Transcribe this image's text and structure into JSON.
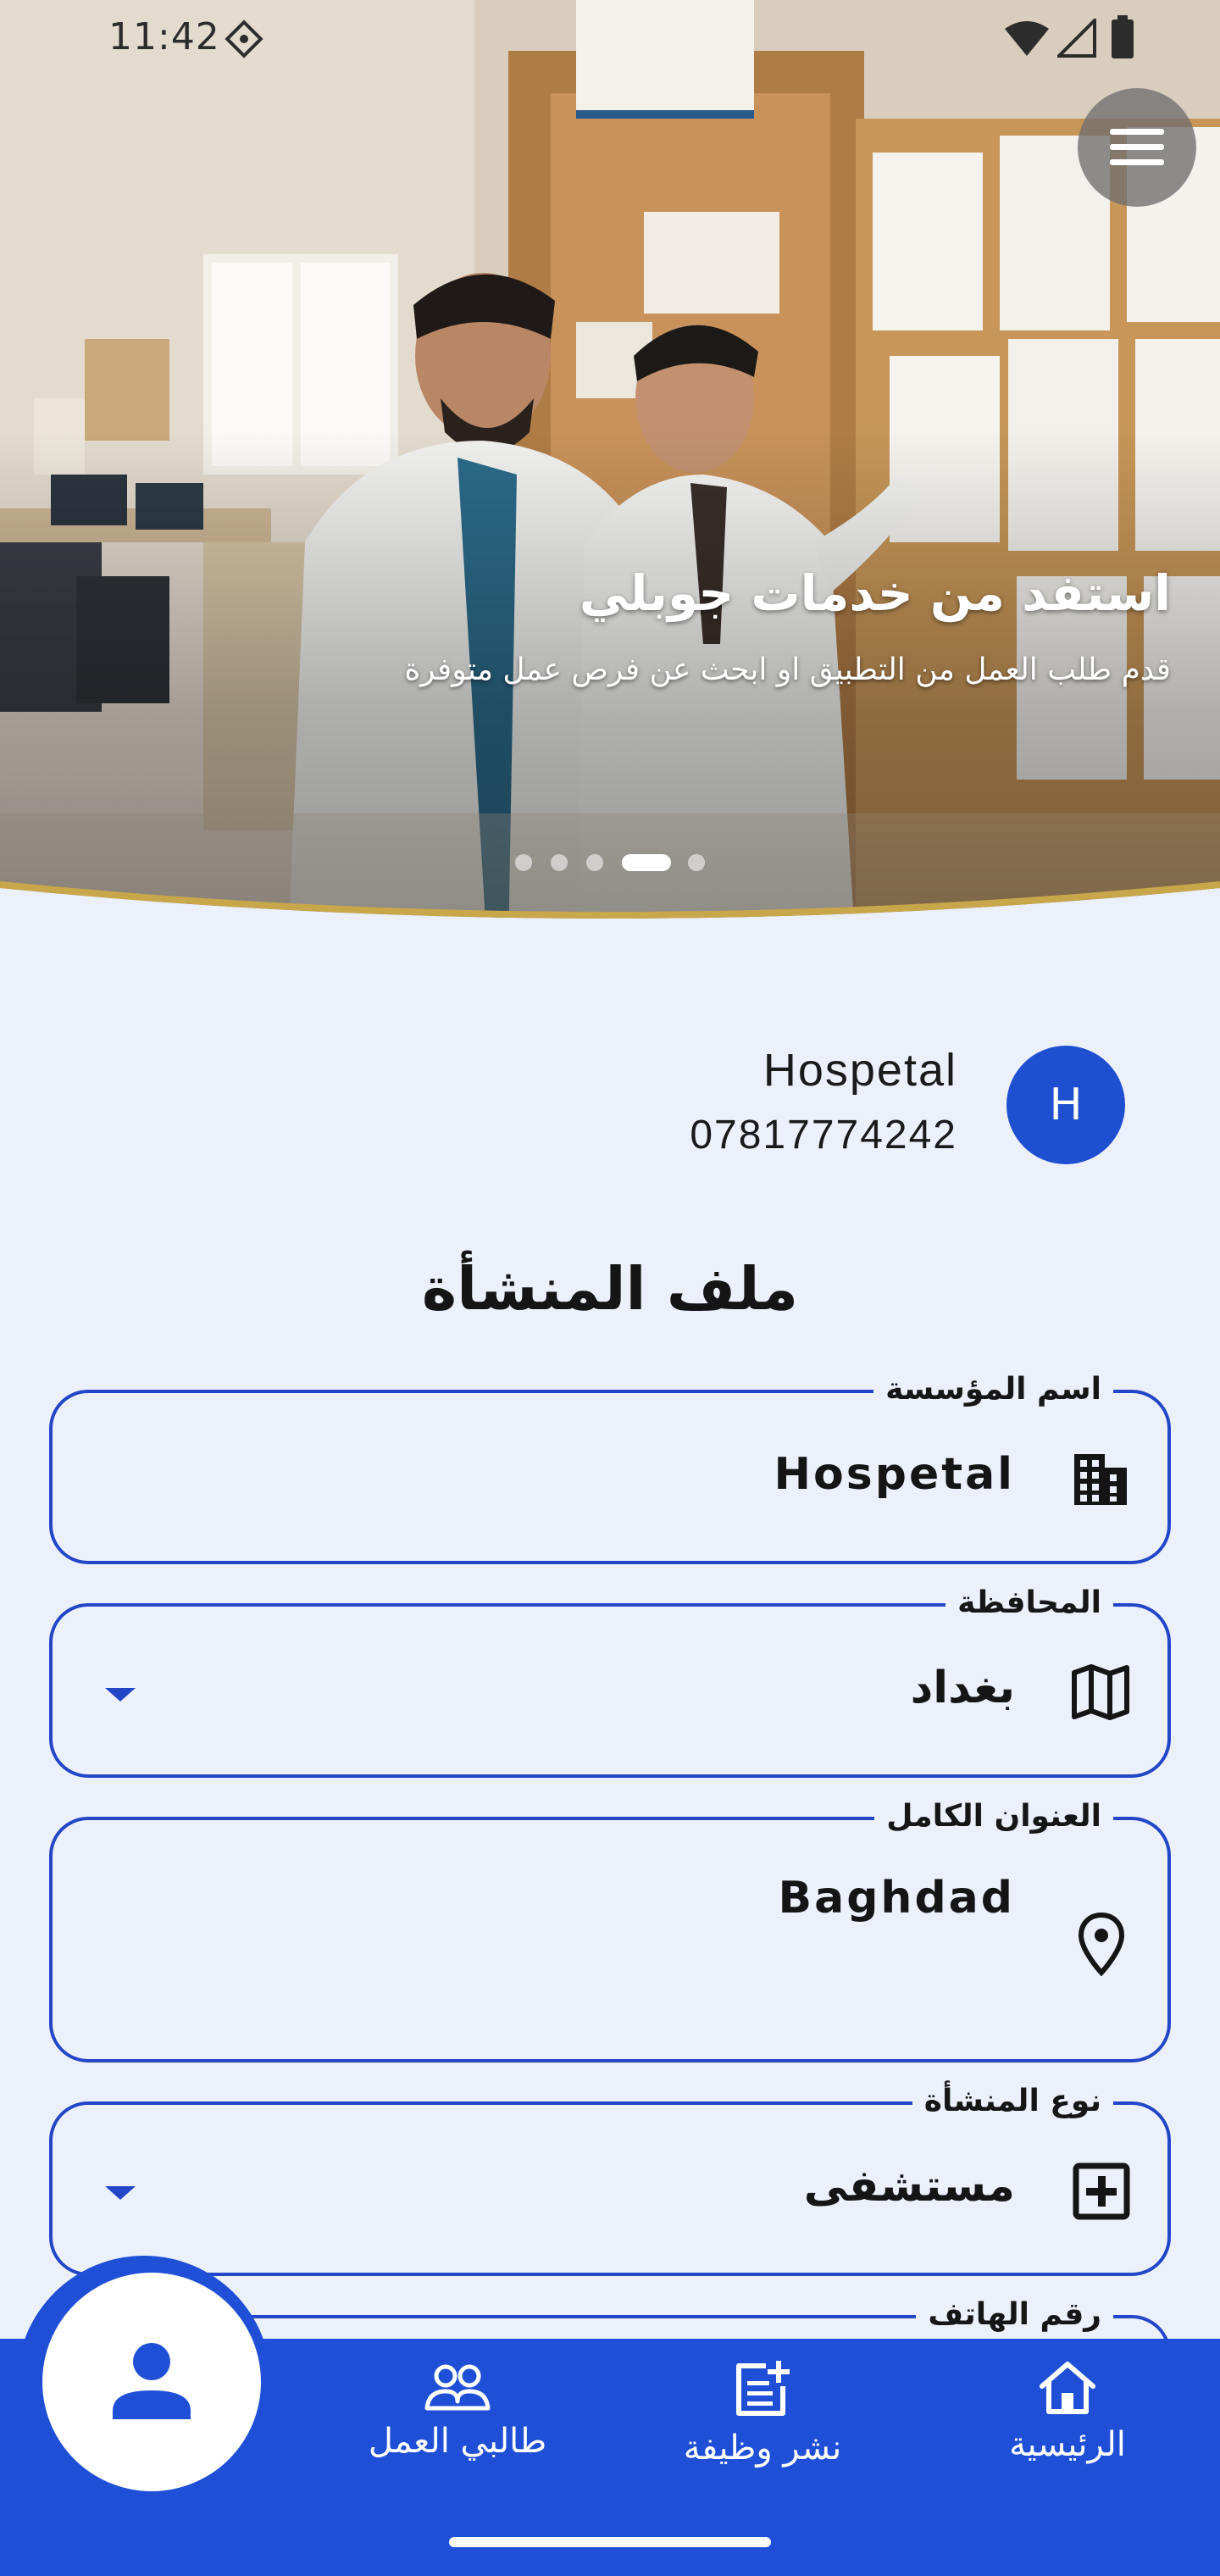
{
  "status_bar": {
    "time": "11:42",
    "icons": [
      "location-diamond-icon",
      "wifi-icon",
      "signal-icon",
      "battery-icon"
    ]
  },
  "hero": {
    "title": "استفد من خدمات جوبلي",
    "subtitle": "قدم طلب العمل من التطبيق او ابحث عن فرص عمل متوفرة",
    "slide_count": 5,
    "active_slide": 4
  },
  "profile": {
    "avatar_letter": "H",
    "name": "Hospetal",
    "phone": "07817774242"
  },
  "page_title": "ملف المنشأة",
  "form": {
    "institution_name": {
      "label": "اسم المؤسسة",
      "value": "Hospetal",
      "icon": "building-icon"
    },
    "governorate": {
      "label": "المحافظة",
      "value": "بغداد",
      "icon": "map-icon"
    },
    "address": {
      "label": "العنوان الكامل",
      "value": "Baghdad",
      "icon": "location-pin-icon"
    },
    "facility_type": {
      "label": "نوع المنشأة",
      "value": "مستشفى",
      "icon": "medical-plus-icon"
    },
    "phone": {
      "label": "رقم الهاتف"
    }
  },
  "bottom_nav": {
    "home": "الرئيسية",
    "post_job": "نشر وظيفة",
    "job_seekers": "طالبي العمل"
  },
  "colors": {
    "primary": "#1f4fd6",
    "field_border": "#2346c9",
    "background": "#ecf0fb",
    "hero_curve_gold": "#c8a64a"
  }
}
